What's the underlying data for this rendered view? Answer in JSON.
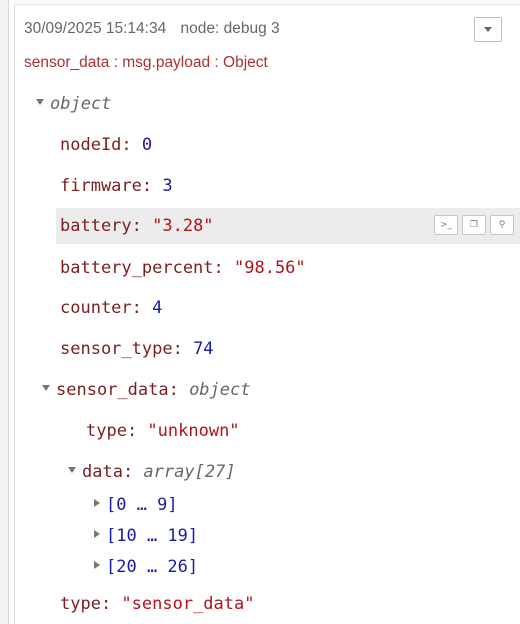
{
  "header": {
    "timestamp": "30/09/2025 15:14:34",
    "node": "node: debug 3",
    "topic": "sensor_data : msg.payload : Object"
  },
  "tree": {
    "root_type": "object",
    "nodeId_key": "nodeId: ",
    "nodeId_val": "0",
    "firmware_key": "firmware: ",
    "firmware_val": "3",
    "battery_key": "battery: ",
    "battery_val": "\"3.28\"",
    "battery_percent_key": "battery_percent: ",
    "battery_percent_val": "\"98.56\"",
    "counter_key": "counter: ",
    "counter_val": "4",
    "sensor_type_key": "sensor_type: ",
    "sensor_type_val": "74",
    "sensor_data_key": "sensor_data: ",
    "sensor_data_type": "object",
    "inner_type_key": "type: ",
    "inner_type_val": "\"unknown\"",
    "data_key": "data: ",
    "data_type": "array[27]",
    "ranges": [
      "[0 … 9]",
      "[10 … 19]",
      "[20 … 26]"
    ],
    "type_key": "type: ",
    "type_val": "\"sensor_data\""
  },
  "icons": {
    "topic_menu": "chevron-down-icon",
    "copy_path": "terminal-icon",
    "copy_value": "copy-icon",
    "pin": "pin-icon"
  },
  "colors": {
    "key": "#7a1e1e",
    "number": "#1a1aa6",
    "string": "#b3121b",
    "type": "#666666",
    "highlight": "#ececec"
  }
}
